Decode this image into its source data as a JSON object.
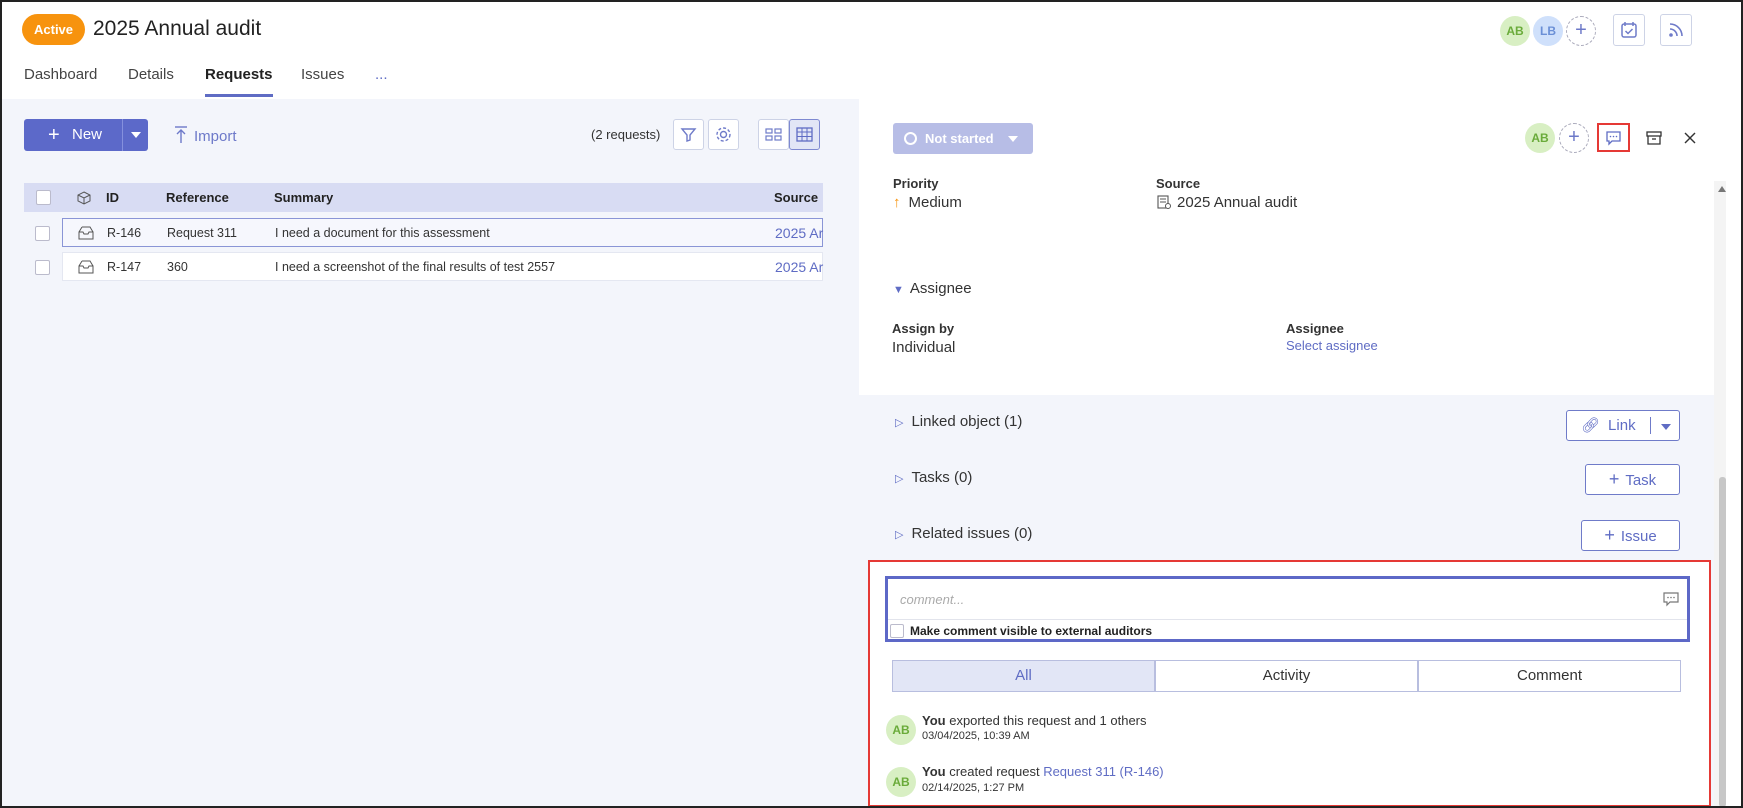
{
  "header": {
    "status_badge": "Active",
    "title": "2025 Annual audit",
    "tabs": [
      {
        "label": "Dashboard"
      },
      {
        "label": "Details"
      },
      {
        "label": "Requests"
      },
      {
        "label": "Issues"
      },
      {
        "label": "..."
      }
    ],
    "avatars": [
      {
        "initials": "AB"
      },
      {
        "initials": "LB"
      }
    ],
    "add_member": "+"
  },
  "toolbar": {
    "new_label": "New",
    "import_label": "Import",
    "request_count": "(2 requests)"
  },
  "table": {
    "columns": [
      "ID",
      "Reference",
      "Summary",
      "Source"
    ],
    "rows": [
      {
        "id": "R-146",
        "reference": "Request 311",
        "summary": "I need a document for this assessment",
        "source": "2025 Ar"
      },
      {
        "id": "R-147",
        "reference": "360",
        "summary": "I need a screenshot of the final results of test 2557",
        "source": "2025 Ar"
      }
    ]
  },
  "detail": {
    "status_label": "Not started",
    "assignee_avatar": "AB",
    "priority_label": "Priority",
    "priority_value": "Medium",
    "source_label": "Source",
    "source_value": "2025 Annual audit",
    "assignee_section": "Assignee",
    "assign_by_label": "Assign by",
    "assign_by_value": "Individual",
    "assignee_label": "Assignee",
    "assignee_value": "Select assignee",
    "linked_object": "Linked object (1)",
    "link_button": "Link",
    "tasks": "Tasks (0)",
    "task_button": "Task",
    "related_issues": "Related issues (0)",
    "issue_button": "Issue"
  },
  "comments": {
    "placeholder": "comment...",
    "external_checkbox": "Make comment visible to external auditors",
    "filters": [
      "All",
      "Activity",
      "Comment"
    ],
    "activity": [
      {
        "avatar": "AB",
        "actor": "You",
        "text": "exported this request and 1 others",
        "link": "",
        "date": "03/04/2025, 10:39 AM"
      },
      {
        "avatar": "AB",
        "actor": "You",
        "text": "created request",
        "link": "Request 311 (R-146)",
        "date": "02/14/2025, 1:27 PM"
      }
    ]
  },
  "colors": {
    "accent": "#5f6cc4",
    "active_badge": "#f7930e",
    "highlight_box": "#e53935"
  }
}
